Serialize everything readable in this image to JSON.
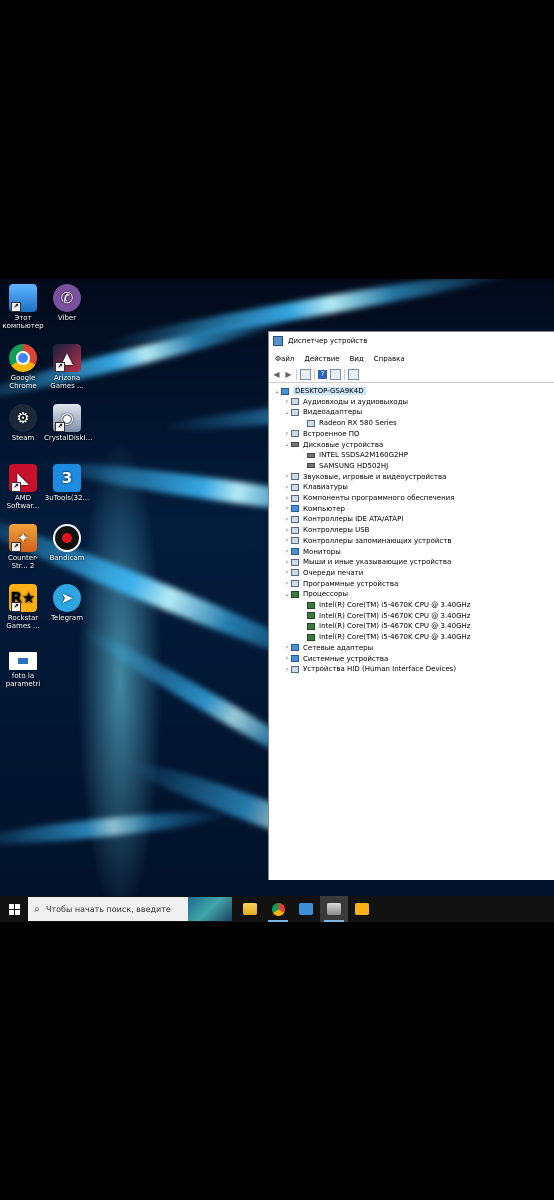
{
  "desktop": {
    "icons": [
      {
        "label": "Этот компьютер",
        "icon": "this-pc-icon"
      },
      {
        "label": "Viber",
        "icon": "viber-icon"
      },
      {
        "label": "Google Chrome",
        "icon": "chrome-icon"
      },
      {
        "label": "Arizona Games ...",
        "icon": "arizona-games-icon"
      },
      {
        "label": "Steam",
        "icon": "steam-icon"
      },
      {
        "label": "CrystalDiskI...",
        "icon": "crystaldisk-icon"
      },
      {
        "label": "AMD Softwar...",
        "icon": "amd-software-icon"
      },
      {
        "label": "3uTools(32...",
        "icon": "3utools-icon"
      },
      {
        "label": "Counter-Str... 2",
        "icon": "counter-strike-icon"
      },
      {
        "label": "Bandicam",
        "icon": "bandicam-icon"
      },
      {
        "label": "Rockstar Games ...",
        "icon": "rockstar-icon"
      },
      {
        "label": "Telegram",
        "icon": "telegram-icon"
      },
      {
        "label": "foto la parametri",
        "icon": "image-file-icon"
      }
    ]
  },
  "window": {
    "title": "Диспетчер устройств",
    "menu": [
      "Файл",
      "Действие",
      "Вид",
      "Справка"
    ],
    "tree": [
      {
        "label": "DESKTOP-GSA9K4D",
        "level": 0,
        "expander": "v",
        "icon": "pc"
      },
      {
        "label": "Аудиовходы и аудиовыходы",
        "level": 1,
        "expander": ">",
        "icon": "audio"
      },
      {
        "label": "Видеоадаптеры",
        "level": 1,
        "expander": "v",
        "icon": "display"
      },
      {
        "label": "Radeon RX 580 Series",
        "level": 2,
        "expander": "",
        "icon": "display"
      },
      {
        "label": "Встроенное ПО",
        "level": 1,
        "expander": ">",
        "icon": "firmware"
      },
      {
        "label": "Дисковые устройства",
        "level": 1,
        "expander": "v",
        "icon": "disk"
      },
      {
        "label": "INTEL SSDSA2M160G2HP",
        "level": 2,
        "expander": "",
        "icon": "disk"
      },
      {
        "label": "SAMSUNG HD502HJ",
        "level": 2,
        "expander": "",
        "icon": "disk"
      },
      {
        "label": "Звуковые, игровые и видеоустройства",
        "level": 1,
        "expander": ">",
        "icon": "sound"
      },
      {
        "label": "Клавиатуры",
        "level": 1,
        "expander": ">",
        "icon": "keyboard"
      },
      {
        "label": "Компоненты программного обеспечения",
        "level": 1,
        "expander": ">",
        "icon": "software"
      },
      {
        "label": "Компьютер",
        "level": 1,
        "expander": ">",
        "icon": "pc"
      },
      {
        "label": "Контроллеры IDE ATA/ATAPI",
        "level": 1,
        "expander": ">",
        "icon": "ide"
      },
      {
        "label": "Контроллеры USB",
        "level": 1,
        "expander": ">",
        "icon": "usb"
      },
      {
        "label": "Контроллеры запоминающих устройств",
        "level": 1,
        "expander": ">",
        "icon": "storage"
      },
      {
        "label": "Мониторы",
        "level": 1,
        "expander": ">",
        "icon": "pc"
      },
      {
        "label": "Мыши и иные указывающие устройства",
        "level": 1,
        "expander": ">",
        "icon": "mouse"
      },
      {
        "label": "Очереди печати",
        "level": 1,
        "expander": ">",
        "icon": "printer"
      },
      {
        "label": "Программные устройства",
        "level": 1,
        "expander": ">",
        "icon": "software"
      },
      {
        "label": "Процессоры",
        "level": 1,
        "expander": "v",
        "icon": "cpu"
      },
      {
        "label": "Intel(R) Core(TM) i5-4670K CPU @ 3.40GHz",
        "level": 2,
        "expander": "",
        "icon": "cpu"
      },
      {
        "label": "Intel(R) Core(TM) i5-4670K CPU @ 3.40GHz",
        "level": 2,
        "expander": "",
        "icon": "cpu"
      },
      {
        "label": "Intel(R) Core(TM) i5-4670K CPU @ 3.40GHz",
        "level": 2,
        "expander": "",
        "icon": "cpu"
      },
      {
        "label": "Intel(R) Core(TM) i5-4670K CPU @ 3.40GHz",
        "level": 2,
        "expander": "",
        "icon": "cpu"
      },
      {
        "label": "Сетевые адаптеры",
        "level": 1,
        "expander": ">",
        "icon": "pc"
      },
      {
        "label": "Системные устройства",
        "level": 1,
        "expander": ">",
        "icon": "pc"
      },
      {
        "label": "Устройства HID (Human Interface Devices)",
        "level": 1,
        "expander": ">",
        "icon": "hid"
      }
    ]
  },
  "taskbar": {
    "search_placeholder": "Чтобы начать поиск, введите",
    "pinned": [
      "file-explorer-icon",
      "chrome-icon",
      "mail-icon",
      "device-manager-icon",
      "rockstar-icon"
    ]
  }
}
